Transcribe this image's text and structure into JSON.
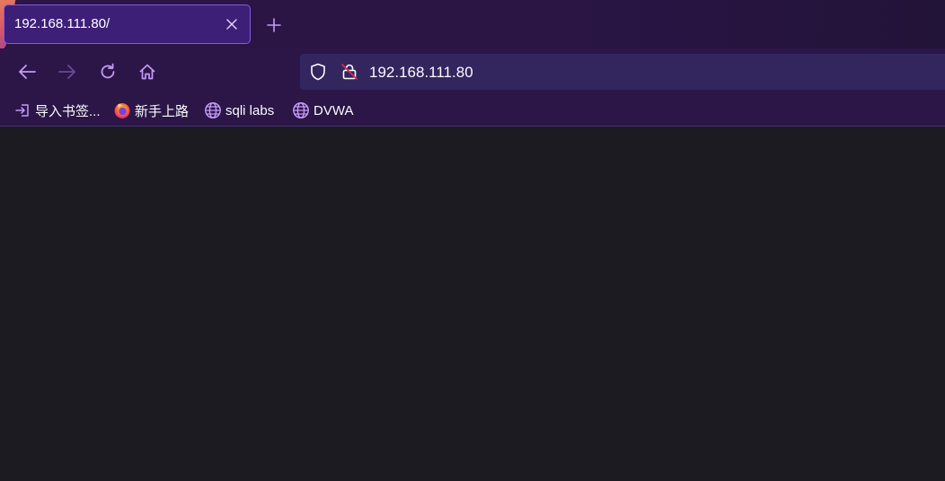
{
  "tab": {
    "title": "192.168.111.80/"
  },
  "navbar": {
    "url": "192.168.111.80"
  },
  "bookmarks": [
    {
      "label": "导入书签...",
      "icon": "import-icon"
    },
    {
      "label": "新手上路",
      "icon": "firefox-icon"
    },
    {
      "label": "sqli labs",
      "icon": "globe-icon"
    },
    {
      "label": "DVWA",
      "icon": "globe-icon"
    }
  ],
  "colors": {
    "accent": "#c59af7",
    "tab_bg": "#3e1f78",
    "toolbar_bg": "#2b1647",
    "content_bg": "#1c1b22"
  }
}
